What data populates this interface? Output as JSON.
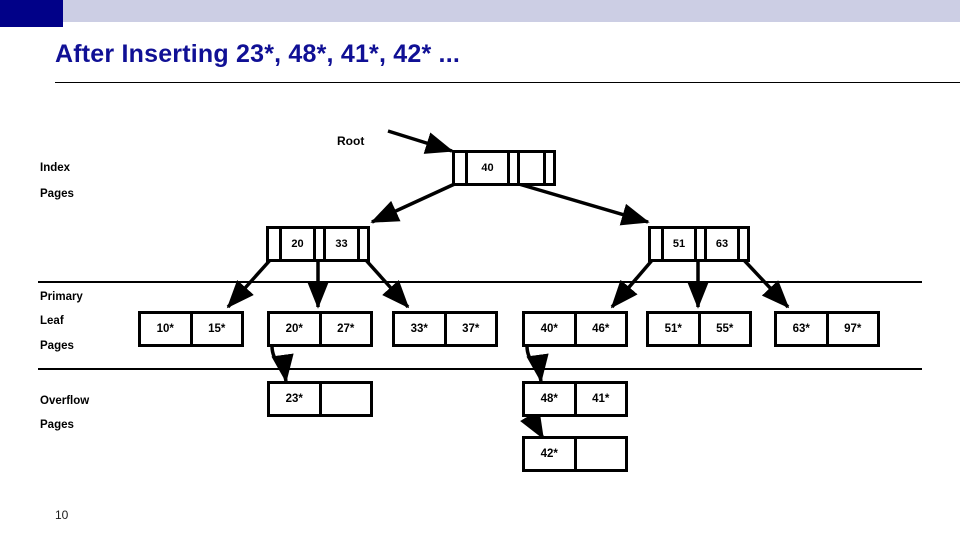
{
  "slide": {
    "title": "After Inserting 23*, 48*, 41*, 42* ...",
    "page_number": "10",
    "accent_dark": "#010188",
    "accent_light": "#cccee4",
    "title_color": "#101095"
  },
  "labels": {
    "root": "Root",
    "index": "Index",
    "index_pages": "Pages",
    "primary": "Primary",
    "leaf": "Leaf",
    "primary_pages": "Pages",
    "overflow": "Overflow",
    "overflow_pages": "Pages"
  },
  "tree": {
    "root_node": {
      "name": "root-node",
      "cells": [
        "",
        "40",
        "",
        "",
        ""
      ]
    },
    "index_nodes": [
      {
        "name": "index-node-left",
        "cells": [
          "",
          "20",
          "",
          "33",
          ""
        ]
      },
      {
        "name": "index-node-right",
        "cells": [
          "",
          "51",
          "",
          "63",
          ""
        ]
      }
    ],
    "leaf_nodes": [
      {
        "name": "leaf-node-1",
        "cells": [
          "10*",
          "15*"
        ]
      },
      {
        "name": "leaf-node-2",
        "cells": [
          "20*",
          "27*"
        ]
      },
      {
        "name": "leaf-node-3",
        "cells": [
          "33*",
          "37*"
        ]
      },
      {
        "name": "leaf-node-4",
        "cells": [
          "40*",
          "46*"
        ]
      },
      {
        "name": "leaf-node-5",
        "cells": [
          "51*",
          "55*"
        ]
      },
      {
        "name": "leaf-node-6",
        "cells": [
          "63*",
          "97*"
        ]
      }
    ],
    "overflow_nodes": [
      {
        "name": "overflow-node-23",
        "cells": [
          "23*",
          ""
        ]
      },
      {
        "name": "overflow-node-48-41",
        "cells": [
          "48*",
          "41*"
        ]
      },
      {
        "name": "overflow-node-42",
        "cells": [
          "42*",
          ""
        ]
      }
    ]
  }
}
